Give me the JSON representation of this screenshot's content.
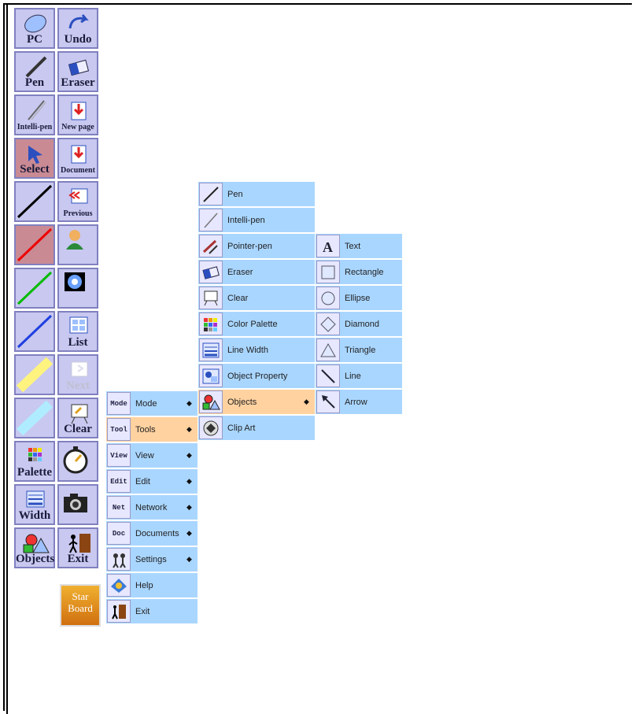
{
  "toolbar": {
    "buttons": [
      {
        "label": "PC",
        "icon": "mouse-icon"
      },
      {
        "label": "Undo",
        "icon": "undo-arrow-icon"
      },
      {
        "label": "Pen",
        "icon": "pen-icon"
      },
      {
        "label": "Eraser",
        "icon": "eraser-icon"
      },
      {
        "label": "Intelli-pen",
        "icon": "intelli-pen-icon"
      },
      {
        "label": "New page",
        "icon": "new-page-icon"
      },
      {
        "label": "Select",
        "icon": "select-arrow-icon"
      },
      {
        "label": "Document",
        "icon": "document-icon"
      },
      {
        "label": "",
        "icon": "black-line-icon"
      },
      {
        "label": "Previous",
        "icon": "previous-page-icon"
      },
      {
        "label": "",
        "icon": "red-line-icon"
      },
      {
        "label": "",
        "icon": "user-icon"
      },
      {
        "label": "",
        "icon": "green-line-icon"
      },
      {
        "label": "",
        "icon": "screen-capture-icon"
      },
      {
        "label": "",
        "icon": "blue-line-icon"
      },
      {
        "label": "List",
        "icon": "list-icon"
      },
      {
        "label": "",
        "icon": "yellow-highlighter-icon"
      },
      {
        "label": "Next",
        "icon": "next-page-icon"
      },
      {
        "label": "",
        "icon": "cyan-highlighter-icon"
      },
      {
        "label": "Clear",
        "icon": "clear-board-icon"
      },
      {
        "label": "Palette",
        "icon": "palette-icon"
      },
      {
        "label": "",
        "icon": "stopwatch-icon"
      },
      {
        "label": "Width",
        "icon": "width-icon"
      },
      {
        "label": "",
        "icon": "camera-icon"
      },
      {
        "label": "Objects",
        "icon": "objects-icon"
      },
      {
        "label": "Exit",
        "icon": "exit-icon"
      }
    ],
    "starboard": {
      "line1": "Star",
      "line2": "Board"
    }
  },
  "main_menu": [
    {
      "label": "Mode",
      "tag": "Mode",
      "submenu": true
    },
    {
      "label": "Tools",
      "tag": "Tool",
      "submenu": true,
      "highlight": true
    },
    {
      "label": "View",
      "tag": "View",
      "submenu": true
    },
    {
      "label": "Edit",
      "tag": "Edit",
      "submenu": true
    },
    {
      "label": "Network",
      "tag": "Net",
      "submenu": true
    },
    {
      "label": "Documents",
      "tag": "Doc",
      "submenu": true
    },
    {
      "label": "Settings",
      "tag": "",
      "submenu": true
    },
    {
      "label": "Help",
      "tag": "",
      "submenu": false
    },
    {
      "label": "Exit",
      "tag": "",
      "submenu": false
    }
  ],
  "tools_menu": [
    {
      "label": "Pen",
      "submenu": false
    },
    {
      "label": "Intelli-pen",
      "submenu": false
    },
    {
      "label": "Pointer-pen",
      "submenu": false
    },
    {
      "label": "Eraser",
      "submenu": false
    },
    {
      "label": "Clear",
      "submenu": false
    },
    {
      "label": "Color Palette",
      "submenu": false
    },
    {
      "label": "Line Width",
      "submenu": false
    },
    {
      "label": "Object Property",
      "submenu": false
    },
    {
      "label": "Objects",
      "submenu": true,
      "highlight": true
    },
    {
      "label": "Clip Art",
      "submenu": false
    }
  ],
  "objects_menu": [
    {
      "label": "Text"
    },
    {
      "label": "Rectangle"
    },
    {
      "label": "Ellipse"
    },
    {
      "label": "Diamond"
    },
    {
      "label": "Triangle"
    },
    {
      "label": "Line"
    },
    {
      "label": "Arrow"
    }
  ],
  "submenu_arrow": "◆"
}
